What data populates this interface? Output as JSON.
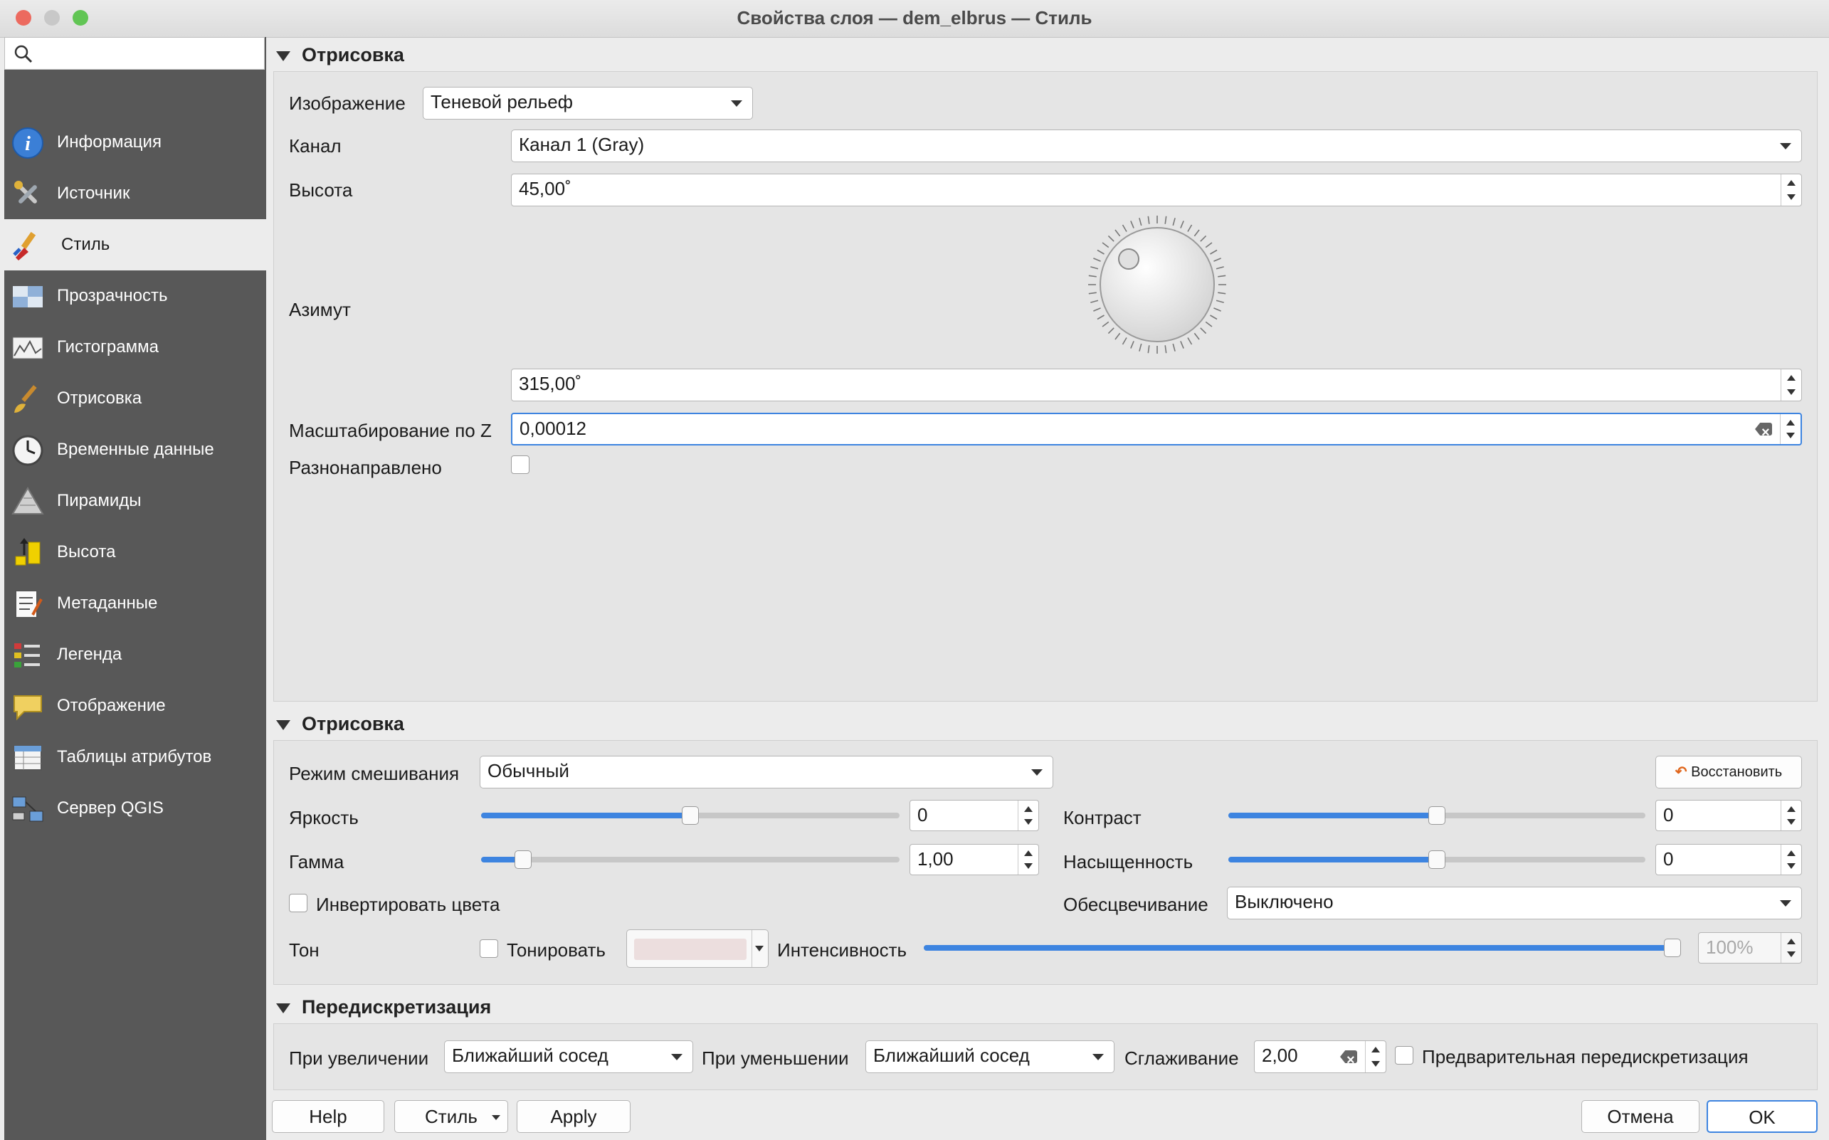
{
  "window": {
    "title": "Свойства слоя — dem_elbrus — Стиль"
  },
  "sidebar": {
    "search_placeholder": "",
    "items": [
      {
        "label": "Информация",
        "icon": "info-icon"
      },
      {
        "label": "Источник",
        "icon": "tools-icon"
      },
      {
        "label": "Стиль",
        "icon": "paintbrush-icon",
        "selected": true
      },
      {
        "label": "Прозрачность",
        "icon": "transparency-icon"
      },
      {
        "label": "Гистограмма",
        "icon": "histogram-icon"
      },
      {
        "label": "Отрисовка",
        "icon": "brush-icon"
      },
      {
        "label": "Временные данные",
        "icon": "clock-icon"
      },
      {
        "label": "Пирамиды",
        "icon": "pyramid-icon"
      },
      {
        "label": "Высота",
        "icon": "elevation-icon"
      },
      {
        "label": "Метаданные",
        "icon": "metadata-icon"
      },
      {
        "label": "Легенда",
        "icon": "legend-icon"
      },
      {
        "label": "Отображение",
        "icon": "display-icon"
      },
      {
        "label": "Таблицы атрибутов",
        "icon": "table-icon"
      },
      {
        "label": "Сервер QGIS",
        "icon": "server-icon"
      }
    ]
  },
  "render_section": {
    "title": "Отрисовка",
    "image_label": "Изображение",
    "image_value": "Теневой рельеф",
    "band_label": "Канал",
    "band_value": "Канал 1 (Gray)",
    "altitude_label": "Высота",
    "altitude_value": "45,00˚",
    "azimuth_label": "Азимут",
    "azimuth_value": "315,00˚",
    "zscale_label": "Масштабирование по Z",
    "zscale_value": "0,00012",
    "multidirectional_label": "Разнонаправлено"
  },
  "color_section": {
    "title": "Отрисовка",
    "blend_label": "Режим смешивания",
    "blend_value": "Обычный",
    "reset_label": "Восстановить",
    "brightness_label": "Яркость",
    "brightness_value": "0",
    "brightness_fraction": 0.5,
    "contrast_label": "Контраст",
    "contrast_value": "0",
    "contrast_fraction": 0.5,
    "gamma_label": "Гамма",
    "gamma_value": "1,00",
    "gamma_fraction": 0.1,
    "saturation_label": "Насыщенность",
    "saturation_value": "0",
    "saturation_fraction": 0.5,
    "invert_label": "Инвертировать цвета",
    "grayscale_label": "Обесцвечивание",
    "grayscale_value": "Выключено",
    "hue_label": "Тон",
    "colorize_label": "Тонировать",
    "intensity_label": "Интенсивность",
    "intensity_value": "100%",
    "intensity_fraction": 1.0,
    "accent_color": "#3d84e0"
  },
  "resample_section": {
    "title": "Передискретизация",
    "zoomed_in_label": "При увеличении",
    "zoomed_in_value": "Ближайший сосед",
    "zoomed_out_label": "При уменьшении",
    "zoomed_out_value": "Ближайший сосед",
    "smoothing_label": "Сглаживание",
    "smoothing_value": "2,00",
    "early_resample_label": "Предварительная передискретизация"
  },
  "buttons": {
    "help": "Help",
    "style": "Стиль",
    "apply": "Apply",
    "cancel": "Отмена",
    "ok": "OK"
  }
}
